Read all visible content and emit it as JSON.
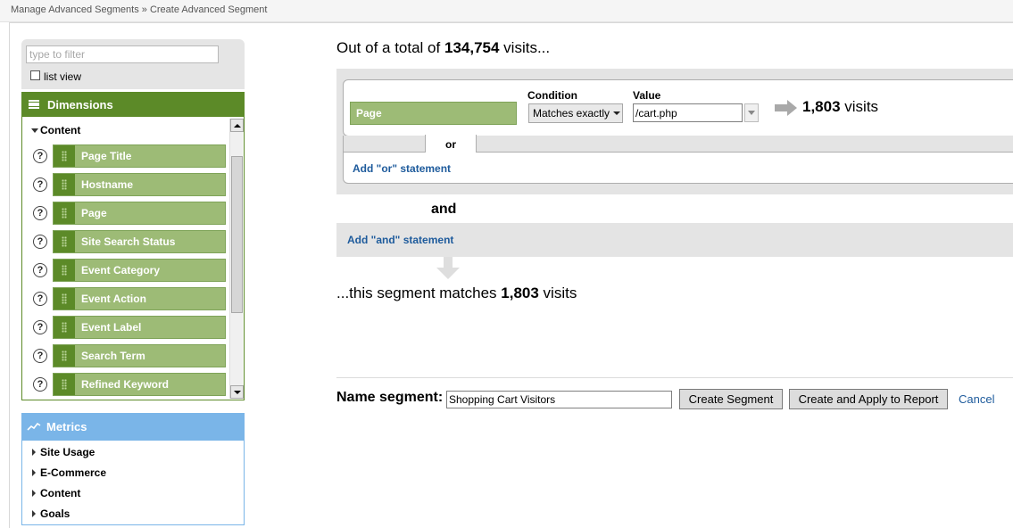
{
  "breadcrumb": "Manage Advanced Segments » Create Advanced Segment",
  "sidebar": {
    "filter_placeholder": "type to filter",
    "list_view_label": "list view",
    "dimensions": {
      "title": "Dimensions",
      "group": "Content",
      "items": [
        {
          "label": "Page Title"
        },
        {
          "label": "Hostname"
        },
        {
          "label": "Page"
        },
        {
          "label": "Site Search Status"
        },
        {
          "label": "Event Category"
        },
        {
          "label": "Event Action"
        },
        {
          "label": "Event Label"
        },
        {
          "label": "Search Term"
        },
        {
          "label": "Refined Keyword"
        }
      ],
      "help_glyph": "?"
    },
    "metrics": {
      "title": "Metrics",
      "items": [
        {
          "label": "Site Usage"
        },
        {
          "label": "E-Commerce"
        },
        {
          "label": "Content"
        },
        {
          "label": "Goals"
        }
      ]
    }
  },
  "main": {
    "total": {
      "prefix": "Out of a total of",
      "value": "134,754",
      "suffix": "visits..."
    },
    "condition": {
      "dimension": "Page",
      "condition_label": "Condition",
      "condition_value": "Matches exactly",
      "value_label": "Value",
      "value": "/cart.php",
      "result_count": "1,803",
      "result_unit": "visits"
    },
    "or_label": "or",
    "add_or": "Add \"or\" statement",
    "and_label": "and",
    "add_and": "Add \"and\" statement",
    "match": {
      "prefix": "...this segment matches",
      "value": "1,803",
      "suffix": "visits"
    },
    "name_label": "Name segment:",
    "name_value": "Shopping Cart Visitors",
    "create_button": "Create Segment",
    "apply_button": "Create and Apply to Report",
    "cancel": "Cancel"
  },
  "colors": {
    "dimension_green": "#5c8a28",
    "pill_green": "#9dbb76",
    "metrics_blue": "#7ab5e8",
    "link_blue": "#1e5b9c"
  }
}
